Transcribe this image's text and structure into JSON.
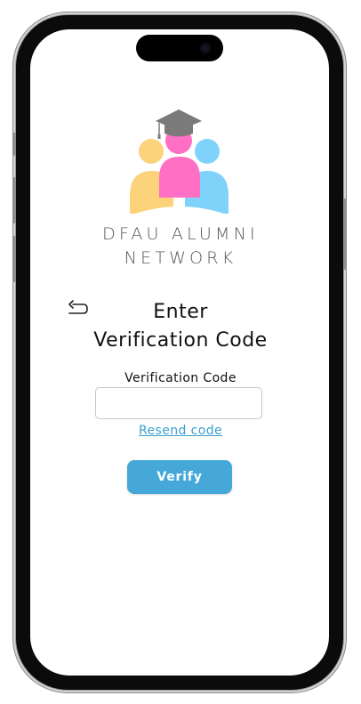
{
  "device": {
    "frame_color": "#0b0b0b",
    "screen_color": "#ffffff"
  },
  "logo": {
    "line1": "DFAU ALUMNI",
    "line2": "NETWORK",
    "colors": {
      "left_person": "#fcd27a",
      "center_person": "#ff6fc3",
      "right_person": "#7fd3fb",
      "cap": "#7a7a7a"
    }
  },
  "header": {
    "back_icon": "back-arrow-icon",
    "title_line1": "Enter",
    "title_line2": "Verification Code"
  },
  "form": {
    "code_label": "Verification Code",
    "code_value": "",
    "code_placeholder": "",
    "resend_label": "Resend code",
    "verify_label": "Verify"
  },
  "colors": {
    "accent": "#45a8d8",
    "link": "#3a9fd0",
    "text": "#111111"
  }
}
